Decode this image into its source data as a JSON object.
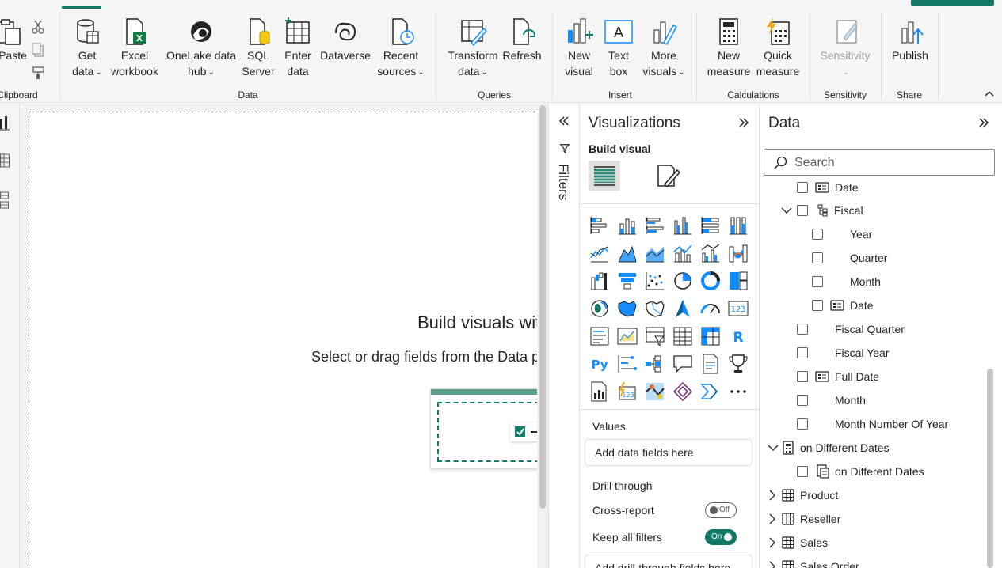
{
  "ribbon": {
    "clipboard": {
      "paste_label": "Paste",
      "group_label": "Clipboard"
    },
    "data": {
      "get_data_line1": "Get",
      "get_data_line2": "data",
      "excel_line1": "Excel",
      "excel_line2": "workbook",
      "onelake_line1": "OneLake data",
      "onelake_line2": "hub",
      "sql_line1": "SQL",
      "sql_line2": "Server",
      "enter_line1": "Enter",
      "enter_line2": "data",
      "dataverse_label": "Dataverse",
      "recent_line1": "Recent",
      "recent_line2": "sources",
      "group_label": "Data"
    },
    "queries": {
      "transform_line1": "Transform",
      "transform_line2": "data",
      "refresh_label": "Refresh",
      "group_label": "Queries"
    },
    "insert": {
      "new_visual_line1": "New",
      "new_visual_line2": "visual",
      "text_box_line1": "Text",
      "text_box_line2": "box",
      "more_visuals_line1": "More",
      "more_visuals_line2": "visuals",
      "group_label": "Insert"
    },
    "calculations": {
      "new_measure_line1": "New",
      "new_measure_line2": "measure",
      "quick_measure_line1": "Quick",
      "quick_measure_line2": "measure",
      "group_label": "Calculations"
    },
    "sensitivity": {
      "label": "Sensitivity",
      "group_label": "Sensitivity"
    },
    "share": {
      "publish_label": "Publish",
      "group_label": "Share"
    }
  },
  "canvas": {
    "title": "Build visuals with your data",
    "subtitle": "Select or drag fields from the Data pane onto the report canvas."
  },
  "filters": {
    "label": "Filters"
  },
  "visualizations": {
    "title": "Visualizations",
    "build_visual_label": "Build visual",
    "values_label": "Values",
    "values_placeholder": "Add data fields here",
    "drill_through_label": "Drill through",
    "cross_report_label": "Cross-report",
    "cross_report_state": "Off",
    "keep_filters_label": "Keep all filters",
    "keep_filters_state": "On",
    "drill_placeholder": "Add drill-through fields here"
  },
  "data_pane": {
    "title": "Data",
    "search_placeholder": "Search",
    "rows": [
      {
        "label": "Date"
      },
      {
        "label": "Fiscal"
      },
      {
        "label": "Year"
      },
      {
        "label": "Quarter"
      },
      {
        "label": "Month"
      },
      {
        "label": "Date"
      },
      {
        "label": "Fiscal Quarter"
      },
      {
        "label": "Fiscal Year"
      },
      {
        "label": "Full Date"
      },
      {
        "label": "Month"
      },
      {
        "label": "Month Number Of Year"
      },
      {
        "label": "on Different Dates"
      },
      {
        "label": "on Different Dates"
      },
      {
        "label": "Product"
      },
      {
        "label": "Reseller"
      },
      {
        "label": "Sales"
      },
      {
        "label": "Sales Order"
      }
    ]
  },
  "colors": {
    "accent": "#117865",
    "viz_blue": "#118dff",
    "viz_dark": "#252423"
  }
}
